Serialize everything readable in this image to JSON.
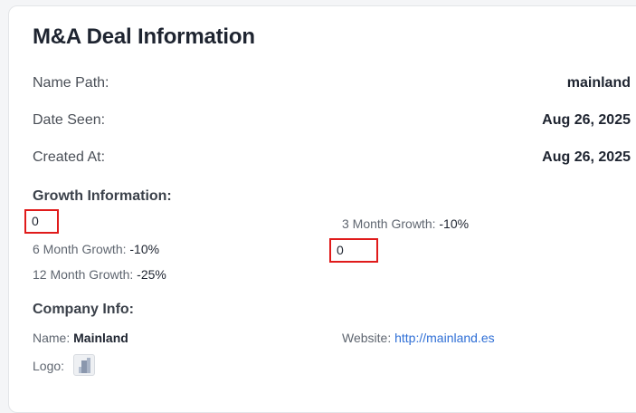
{
  "card": {
    "title": "M&A Deal Information",
    "fields": [
      {
        "label": "Name Path:",
        "value": "mainland"
      },
      {
        "label": "Date Seen:",
        "value": "Aug 26, 2025"
      },
      {
        "label": "Created At:",
        "value": "Aug 26, 2025"
      }
    ]
  },
  "growth": {
    "heading": "Growth Information:",
    "highlighted_values": [
      "0",
      "0"
    ],
    "three_month_label": "3 Month Growth:",
    "three_month_value": "-10%",
    "six_month_label": "6 Month Growth:",
    "six_month_value": "-10%",
    "twelve_month_label": "12 Month Growth:",
    "twelve_month_value": "-25%"
  },
  "company": {
    "heading": "Company Info:",
    "name_label": "Name:",
    "name_value": "Mainland",
    "website_label": "Website:",
    "website_value": "http://mainland.es",
    "logo_label": "Logo:"
  },
  "colors": {
    "highlight_border": "#e01b1b",
    "link": "#2f6fd6"
  },
  "icons": {
    "logo": "company-logo-thumbnail"
  }
}
